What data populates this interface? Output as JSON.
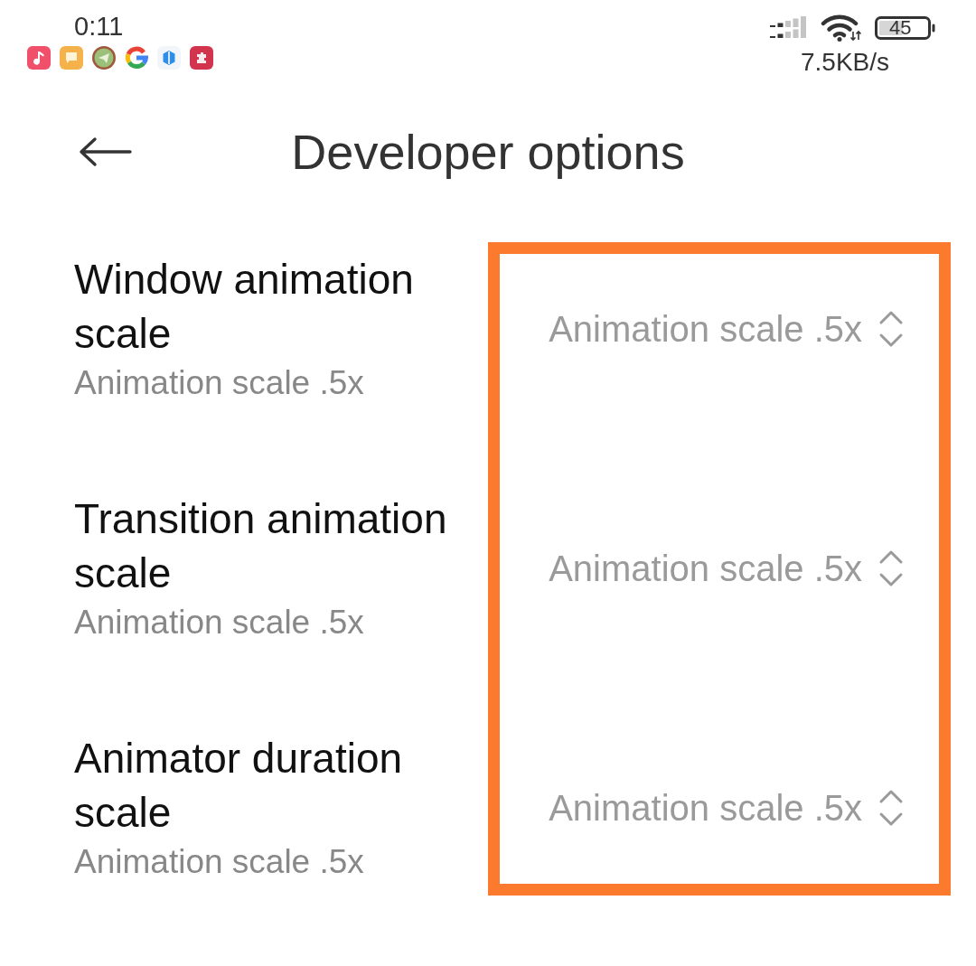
{
  "status_bar": {
    "time": "0:11",
    "battery": "45",
    "network_speed": "7.5KB/s"
  },
  "header": {
    "title": "Developer options"
  },
  "settings": [
    {
      "title": "Window animation scale",
      "summary": "Animation scale .5x",
      "value": "Animation scale .5x"
    },
    {
      "title": "Transition animation scale",
      "summary": "Animation scale .5x",
      "value": "Animation scale .5x"
    },
    {
      "title": "Animator duration scale",
      "summary": "Animation scale .5x",
      "value": "Animation scale .5x"
    }
  ],
  "highlight_frame": true
}
